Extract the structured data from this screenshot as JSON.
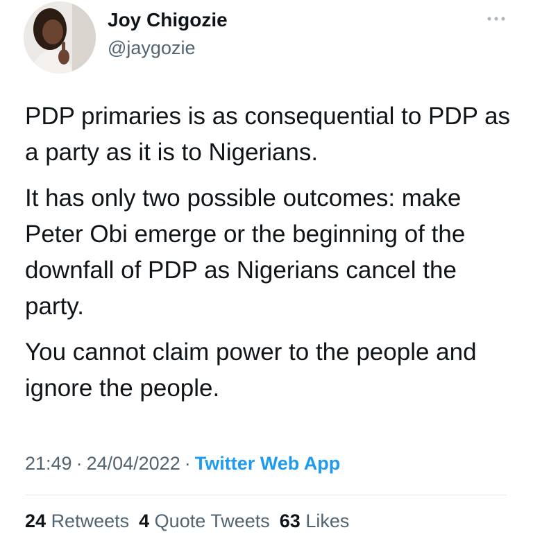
{
  "author": {
    "display_name": "Joy Chigozie",
    "handle": "@jaygozie"
  },
  "tweet": {
    "paragraphs": [
      "PDP primaries is as consequential to PDP as a party as it is to Nigerians.",
      "It has only two possible outcomes: make Peter Obi emerge or the beginning of the downfall of PDP as Nigerians cancel the party.",
      "You cannot claim power to the people and ignore the people."
    ],
    "time": "21:49",
    "date": "24/04/2022",
    "source": "Twitter Web App"
  },
  "stats": {
    "retweets_count": "24",
    "retweets_label": "Retweets",
    "quotes_count": "4",
    "quotes_label": "Quote Tweets",
    "likes_count": "63",
    "likes_label": "Likes"
  },
  "icons": {
    "more": "more-options-icon",
    "avatar": "profile-avatar"
  },
  "colors": {
    "text": "#0f1419",
    "secondary": "#536471",
    "link": "#1d9bf0",
    "divider": "#e6e9eb"
  }
}
